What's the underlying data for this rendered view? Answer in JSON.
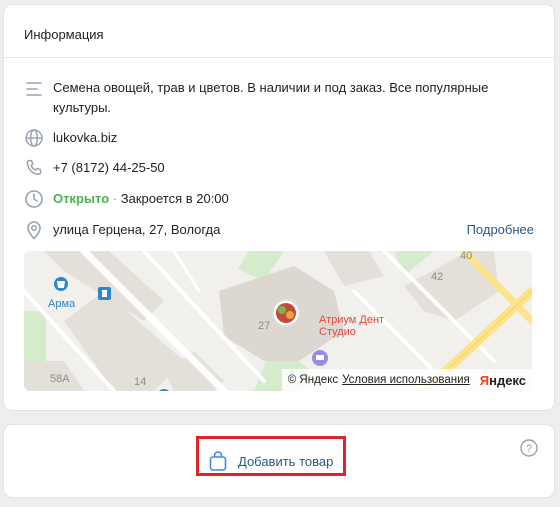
{
  "info": {
    "title": "Информация",
    "description": "Семена овощей, трав и цветов. В наличии и под заказ. Все популярные культуры.",
    "website": "lukovka.biz",
    "phone": "+7 (8172) 44-25-50",
    "status_open": "Открыто",
    "status_sep": " · ",
    "status_close": "Закроется в 20:00",
    "address": "улица Герцена, 27, Вологда",
    "more_link": "Подробнее"
  },
  "map": {
    "poi_name": "Атриум Дент Студио",
    "shop_label": "Арма",
    "house_numbers": [
      "40",
      "42",
      "27",
      "58А",
      "14"
    ],
    "attribution": "© Яндекс",
    "terms_link": "Условия использования",
    "brand_first": "Я",
    "brand_rest": "ндекс",
    "colors": {
      "road": "#ffffff",
      "major_road": "#fde38a",
      "building": "#e3e0da",
      "park": "#d4eccb"
    }
  },
  "actions": {
    "add_product_label": "Добавить товар",
    "help_glyph": "?"
  },
  "colors": {
    "accent": "#2a5885",
    "open_status": "#4bb34b",
    "highlight": "#e0222a"
  }
}
